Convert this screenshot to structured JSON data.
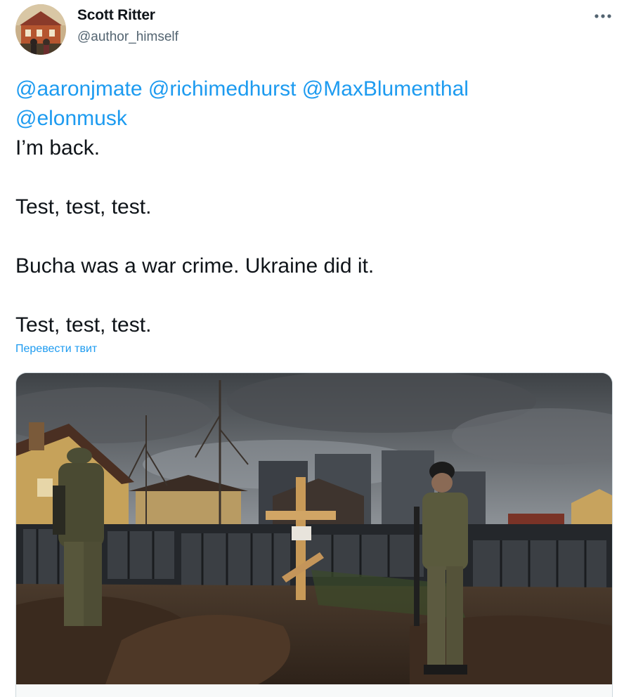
{
  "author": {
    "name": "Scott Ritter",
    "handle": "@author_himself",
    "avatar_icon": "profile-photo"
  },
  "menu": {
    "icon": "more-horizontal-icon"
  },
  "tweet": {
    "mentions": [
      "@aaronjmate",
      "@richimedhurst",
      "@MaxBlumenthal",
      "@elonmusk"
    ],
    "lines": [
      "I’m back.",
      "Test, test, test.",
      "Bucha was a war crime. Ukraine did it.",
      "Test, test, test."
    ],
    "translate_label": "Перевести твит"
  },
  "colors": {
    "link": "#1d9bf0",
    "text": "#0f1419",
    "secondary": "#536471"
  }
}
